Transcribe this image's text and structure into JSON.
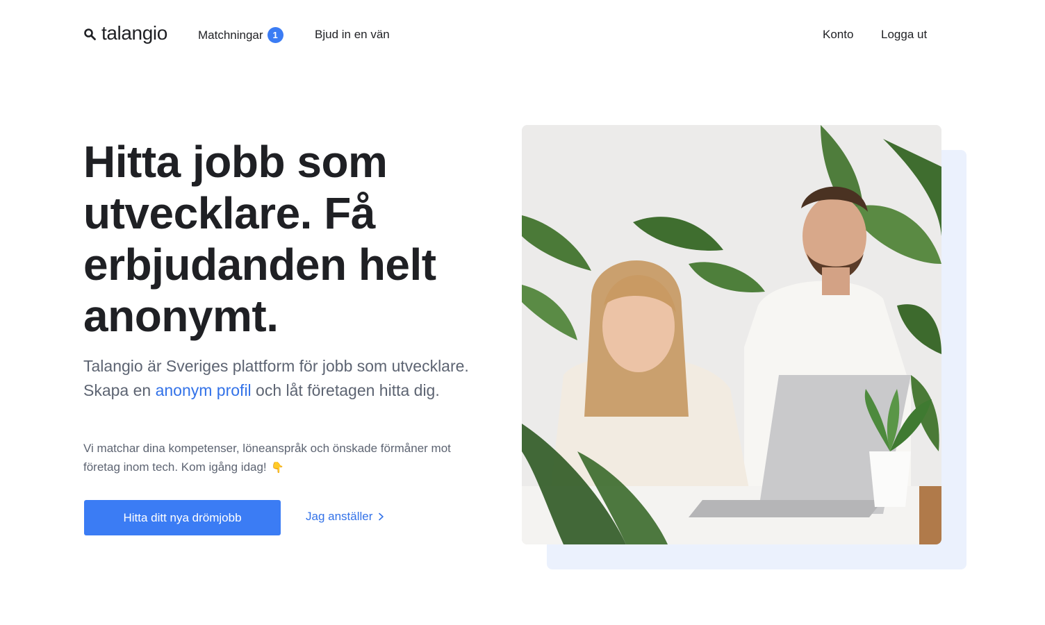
{
  "header": {
    "logo_text": "talangio",
    "nav": {
      "matches_label": "Matchningar",
      "matches_count": "1",
      "invite_label": "Bjud in en vän",
      "account_label": "Konto",
      "logout_label": "Logga ut"
    }
  },
  "hero": {
    "title": "Hitta jobb som utvecklare. Få erbjudanden helt anonymt.",
    "lead_before": "Talangio är Sveriges plattform för jobb som utvecklare. Skapa en ",
    "lead_link": "anonym profil",
    "lead_after": " och låt företagen hitta dig.",
    "sub": "Vi matchar dina kompetenser, löneanspråk och önskade förmåner mot företag inom tech. Kom igång idag!",
    "sub_emoji": "👇",
    "cta_primary": "Hitta ditt nya drömjobb",
    "cta_secondary": "Jag anställer"
  },
  "icons": {
    "logo": "search-icon",
    "cta_secondary": "chevron-right-icon"
  },
  "colors": {
    "accent": "#3b7cf4",
    "link": "#3372e8",
    "text": "#1f2024",
    "muted": "#5d6472",
    "image_backdrop": "#ebf1fd"
  }
}
